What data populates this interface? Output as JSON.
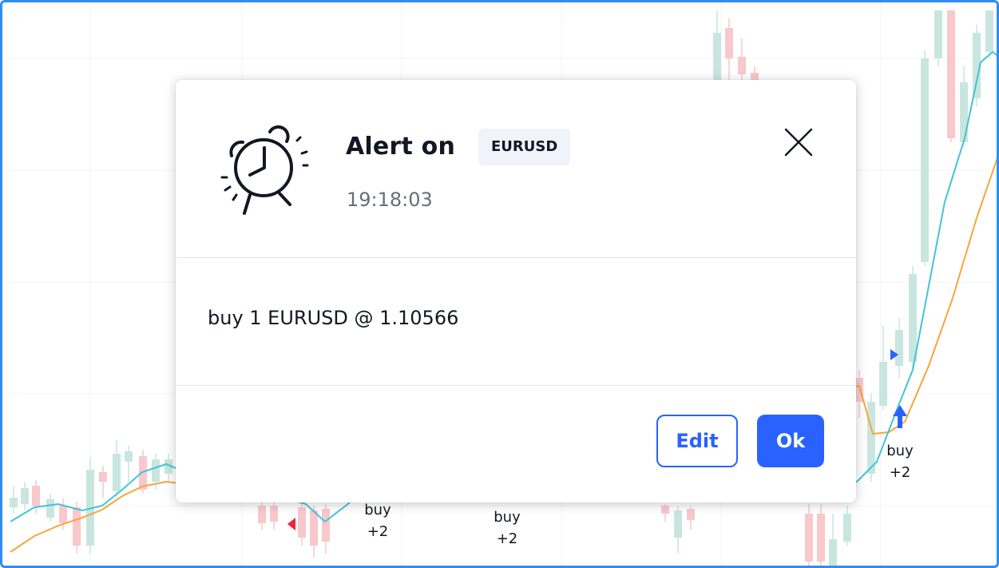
{
  "chart": {
    "signals": [
      {
        "line1": "buy",
        "line2": "+2"
      },
      {
        "line1": "buy",
        "line2": "+2"
      },
      {
        "line1": "buy",
        "line2": "+2"
      }
    ],
    "colors": {
      "up": "#c8e6df",
      "down": "#f8c8cc",
      "fast_ma": "#3fc5d6",
      "slow_ma": "#f7a53c",
      "buy_marker": "#2962ff",
      "sell_marker": "#f0243c"
    }
  },
  "dialog": {
    "icon": "alarm-clock-icon",
    "title": "Alert on",
    "symbol": "EURUSD",
    "time": "19:18:03",
    "message": "buy 1 EURUSD @ 1.10566",
    "edit_label": "Edit",
    "ok_label": "Ok",
    "close_icon": "close-icon"
  },
  "colors": {
    "accent": "#2962ff",
    "frame_border": "#2f8cf0",
    "text": "#131722",
    "muted": "#6a6d78",
    "badge_bg": "#f0f3fa"
  }
}
